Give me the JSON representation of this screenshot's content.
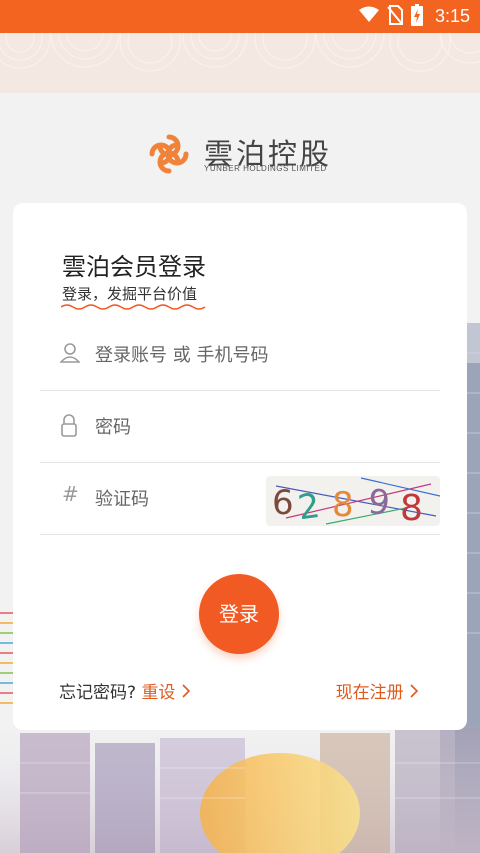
{
  "status_bar": {
    "time": "3:15",
    "bg_color": "#f2641f",
    "icons": [
      "wifi-icon",
      "no-sim-icon",
      "battery-charging-icon"
    ]
  },
  "brand": {
    "name_cn": "雲泊控股",
    "name_en": "YUNBER HOLDINGS LIMITED",
    "accent": "#f15a22"
  },
  "login_card": {
    "title": "雲泊会员登录",
    "subtitle": "登录，发掘平台价值",
    "account": {
      "placeholder": "登录账号 或 手机号码",
      "value": "",
      "icon": "user-icon"
    },
    "password": {
      "placeholder": "密码",
      "value": "",
      "icon": "lock-icon"
    },
    "captcha": {
      "placeholder": "验证码",
      "value": "",
      "icon": "hash-icon",
      "code": "62898"
    },
    "login_button": "登录",
    "forgot_label": "忘记密码?",
    "reset_label": "重设",
    "register_label": "现在注册"
  }
}
